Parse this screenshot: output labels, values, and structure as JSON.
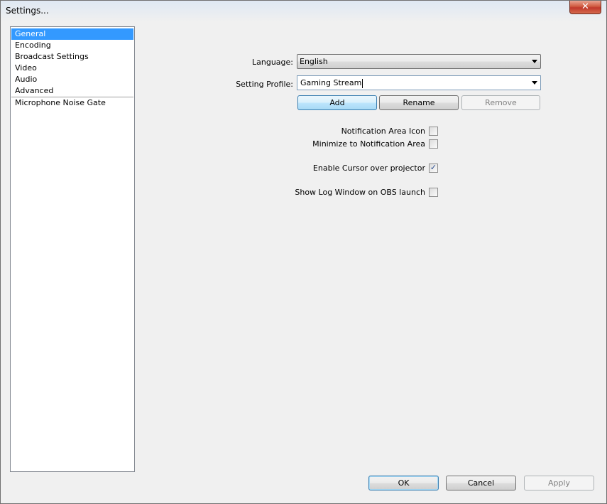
{
  "window": {
    "title": "Settings...",
    "close_label": "✕"
  },
  "nav": {
    "items": [
      {
        "label": "General",
        "selected": true
      },
      {
        "label": "Encoding"
      },
      {
        "label": "Broadcast Settings"
      },
      {
        "label": "Video"
      },
      {
        "label": "Audio"
      },
      {
        "label": "Advanced"
      }
    ],
    "plugins": [
      {
        "label": "Microphone Noise Gate"
      }
    ]
  },
  "general": {
    "language_label": "Language:",
    "language_value": "English",
    "profile_label": "Setting Profile:",
    "profile_value": "Gaming Stream",
    "add_label": "Add",
    "rename_label": "Rename",
    "remove_label": "Remove",
    "options": [
      {
        "label": "Notification Area Icon",
        "checked": false
      },
      {
        "label": "Minimize to Notification Area",
        "checked": false
      },
      {
        "label": "Enable Cursor over projector",
        "checked": true
      },
      {
        "label": "Show Log Window on OBS launch",
        "checked": false
      }
    ]
  },
  "footer": {
    "ok_label": "OK",
    "cancel_label": "Cancel",
    "apply_label": "Apply"
  },
  "check_mark": "✓"
}
